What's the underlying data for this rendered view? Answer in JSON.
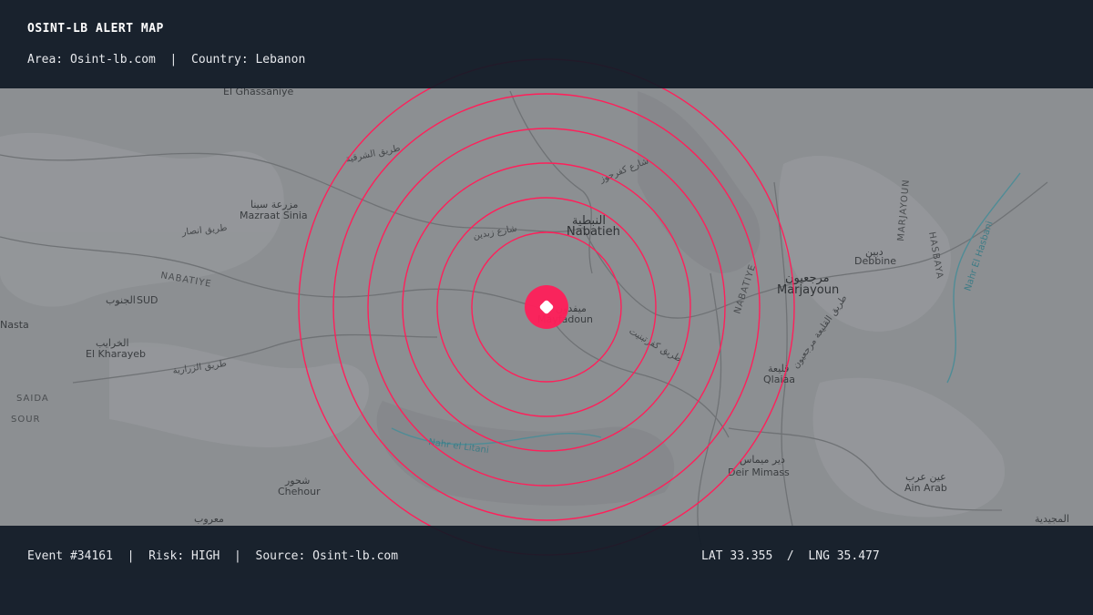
{
  "header": {
    "title": "OSINT-LB ALERT MAP",
    "area_label": "Area:",
    "area_value": "Osint-lb.com",
    "country_label": "Country:",
    "country_value": "Lebanon"
  },
  "footer": {
    "event_label": "Event",
    "event_id": "#34161",
    "risk_label": "Risk:",
    "risk_value": "HIGH",
    "source_label": "Source:",
    "source_value": "Osint-lb.com",
    "lat_label": "LAT",
    "lat_value": "33.355",
    "lng_label": "LNG",
    "lng_value": "35.477"
  },
  "alert": {
    "ring_count": 6,
    "color": "#ff1f5a",
    "marker_icon": "alert-pin-icon"
  },
  "map": {
    "base_color": "#8c8f92",
    "river_color": "#3f7c86",
    "places": [
      {
        "name": "El Ghassaniye",
        "id": "el-ghassaniye"
      },
      {
        "name": "مزرعة سينا",
        "id": "mazraat-sinia-ar"
      },
      {
        "name": "Mazraat Sinia",
        "id": "mazraat-sinia"
      },
      {
        "name": "النبطية",
        "id": "nabatieh-ar"
      },
      {
        "name": "Nabatieh",
        "id": "nabatieh"
      },
      {
        "name": "ميفدون",
        "id": "mayfadoun-ar"
      },
      {
        "name": "Mayfadoun",
        "id": "mayfadoun"
      },
      {
        "name": "الجنوب",
        "id": "sud-ar"
      },
      {
        "name": "SUD",
        "id": "sud"
      },
      {
        "name": "الخرايب",
        "id": "el-kharayeb-ar"
      },
      {
        "name": "El Kharayeb",
        "id": "el-kharayeb"
      },
      {
        "name": "SAIDA",
        "id": "saida"
      },
      {
        "name": "SOUR",
        "id": "sour"
      },
      {
        "name": "Nasta",
        "id": "nasta"
      },
      {
        "name": "شحور",
        "id": "chehour-ar"
      },
      {
        "name": "Chehour",
        "id": "chehour"
      },
      {
        "name": "معروب",
        "id": "maarub-ar"
      },
      {
        "name": "دبين",
        "id": "debbine-ar"
      },
      {
        "name": "Debbine",
        "id": "debbine"
      },
      {
        "name": "مرجعيون",
        "id": "marjayoun-ar"
      },
      {
        "name": "Marjayoun",
        "id": "marjayoun"
      },
      {
        "name": "قليعة",
        "id": "qlaiaa-ar"
      },
      {
        "name": "Qlaiaa",
        "id": "qlaiaa"
      },
      {
        "name": "دير ميماس",
        "id": "deir-mimass-ar"
      },
      {
        "name": "Deir Mimass",
        "id": "deir-mimass"
      },
      {
        "name": "عين عرب",
        "id": "ain-arab-ar"
      },
      {
        "name": "Ain Arab",
        "id": "ain-arab"
      },
      {
        "name": "المجيدية",
        "id": "majidiye-ar"
      }
    ],
    "regions": [
      {
        "name": "NABATIYE",
        "id": "nabatiye-west"
      },
      {
        "name": "NABATIYE",
        "id": "nabatiye-east"
      },
      {
        "name": "MARJAYOUN",
        "id": "marjayoun-district"
      },
      {
        "name": "HASBAYA",
        "id": "hasbaya"
      }
    ],
    "roads": [
      {
        "name": "طريق الشرقية",
        "id": "road-sharqiye"
      },
      {
        "name": "طريق انصار",
        "id": "road-ansar"
      },
      {
        "name": "طريق الزرارية",
        "id": "road-zrariye"
      },
      {
        "name": "شارع زبدين",
        "id": "road-zebdine"
      },
      {
        "name": "شارع كفرجوز",
        "id": "road-kfarjouz"
      },
      {
        "name": "طريق كفرتبنيت",
        "id": "road-kfartebnit"
      },
      {
        "name": "طريق القليعة مرجعيون",
        "id": "road-qlaiaa"
      }
    ],
    "rivers": [
      {
        "name": "Nahr El Hasbani",
        "id": "river-hasbani"
      },
      {
        "name": "Nahr el Litani",
        "id": "river-litani"
      }
    ]
  }
}
